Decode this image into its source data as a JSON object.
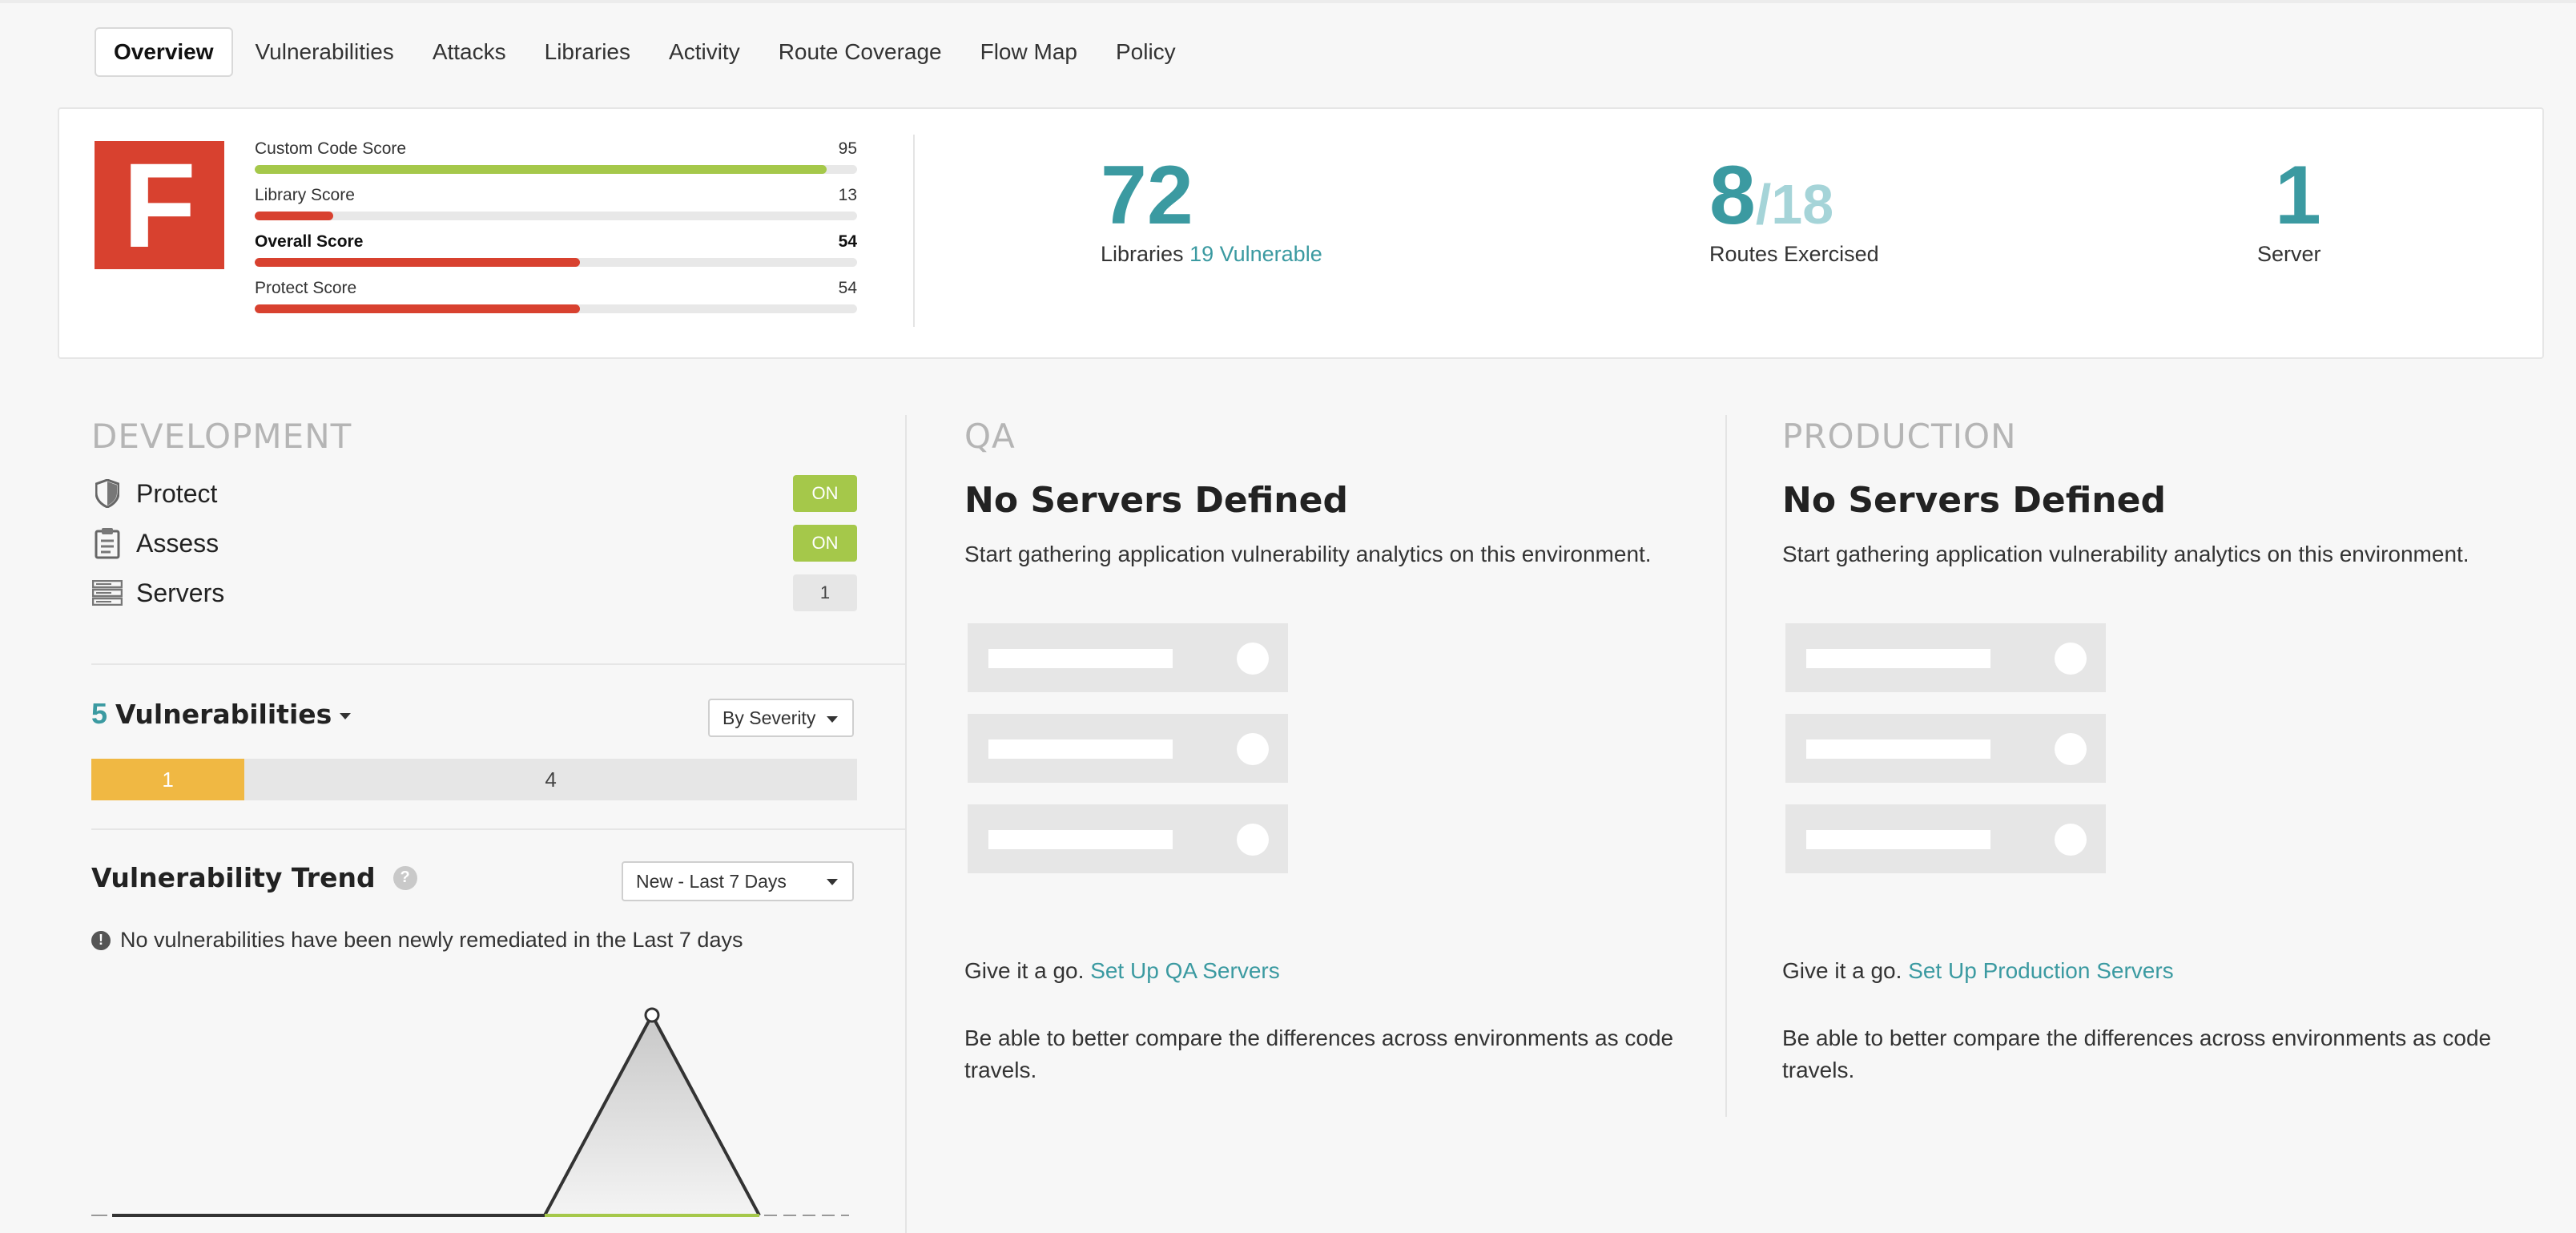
{
  "tabs": [
    {
      "label": "Overview",
      "active": true
    },
    {
      "label": "Vulnerabilities"
    },
    {
      "label": "Attacks"
    },
    {
      "label": "Libraries"
    },
    {
      "label": "Activity"
    },
    {
      "label": "Route Coverage"
    },
    {
      "label": "Flow Map"
    },
    {
      "label": "Policy"
    }
  ],
  "grade": {
    "letter": "F",
    "color": "#d8412f"
  },
  "scores": [
    {
      "label": "Custom Code Score",
      "value": "95",
      "percent": 95,
      "color": "#a5c84a"
    },
    {
      "label": "Library Score",
      "value": "13",
      "percent": 13,
      "color": "#d8412f"
    },
    {
      "label": "Overall Score",
      "value": "54",
      "percent": 54,
      "color": "#d8412f"
    },
    {
      "label": "Protect Score",
      "value": "54",
      "percent": 54,
      "color": "#d8412f"
    }
  ],
  "stats": {
    "libraries": {
      "count": "72",
      "label": "Libraries",
      "vuln_count": "19",
      "vuln_label": "Vulnerable"
    },
    "routes": {
      "exercised": "8",
      "total": "/18",
      "label": "Routes Exercised"
    },
    "servers": {
      "count": "1",
      "label": "Server"
    }
  },
  "development": {
    "title": "DEVELOPMENT",
    "items": [
      {
        "label": "Protect",
        "icon": "shield-icon",
        "badge": "ON"
      },
      {
        "label": "Assess",
        "icon": "clipboard-icon",
        "badge": "ON"
      },
      {
        "label": "Servers",
        "icon": "server-icon",
        "badge": "1"
      }
    ]
  },
  "vulnerabilities": {
    "count": "5",
    "label": "Vulnerabilities",
    "group_by": "By Severity",
    "severity_segments": [
      {
        "value": "1",
        "color": "#f0b843",
        "fraction": 0.2
      },
      {
        "value": "4",
        "color": "#e6e6e6",
        "fraction": 0.8
      }
    ]
  },
  "trend": {
    "title": "Vulnerability Trend",
    "help": "?",
    "range": "New - Last 7 Days",
    "notice": "No vulnerabilities have been newly remediated in the Last 7 days"
  },
  "qa": {
    "title": "QA",
    "heading": "No Servers Defined",
    "desc": "Start gathering application vulnerability analytics on this environment.",
    "go": "Give it a go.",
    "link": "Set Up QA Servers",
    "compare": "Be able to better compare the differences across environments as code travels."
  },
  "production": {
    "title": "PRODUCTION",
    "heading": "No Servers Defined",
    "desc": "Start gathering application vulnerability analytics on this environment.",
    "go": "Give it a go.",
    "link": "Set Up Production Servers",
    "compare": "Be able to better compare the differences across environments as code travels."
  },
  "colors": {
    "accent": "#3b9aa1",
    "ok": "#a5c84a",
    "danger": "#d8412f",
    "warn": "#f0b843"
  }
}
